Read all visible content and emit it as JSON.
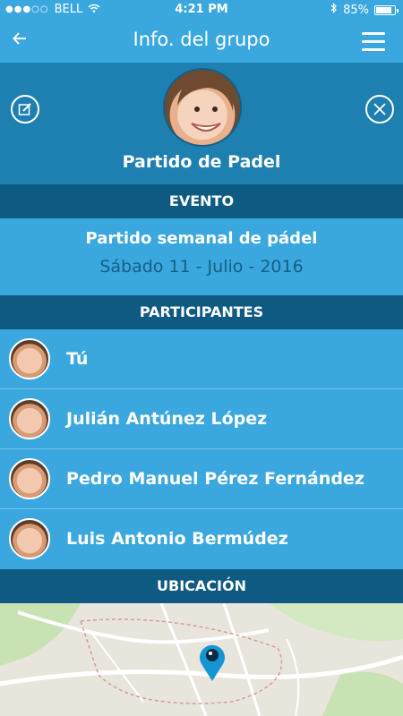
{
  "status_bar": {
    "carrier": "BELL",
    "time": "4:21 PM",
    "battery": "85%",
    "battery_level": 0.85
  },
  "nav": {
    "title": "Info. del grupo"
  },
  "group": {
    "name": "Partido de Padel"
  },
  "sections": {
    "event": "EVENTO",
    "participants": "PARTICIPANTES",
    "location": "UBICACIÓN"
  },
  "event": {
    "name": "Partido semanal de pádel",
    "date": "Sábado 11 - Julio - 2016"
  },
  "participants": [
    {
      "name": "Tú"
    },
    {
      "name": "Julián Antúnez López"
    },
    {
      "name": "Pedro Manuel Pérez Fernández"
    },
    {
      "name": "Luis Antonio Bermúdez"
    }
  ],
  "colors": {
    "primary": "#3aa8df",
    "header_dark": "#1e7fb1",
    "section_bar": "#0e5a83",
    "date_text": "#155f86",
    "map_pin": "#1596d3"
  }
}
